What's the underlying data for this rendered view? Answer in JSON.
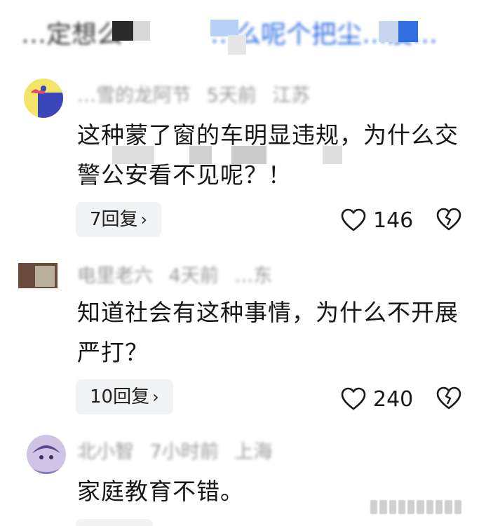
{
  "header": {
    "blurred_left": "…定想么",
    "blurred_right": "…么呢个把尘…没…"
  },
  "comments": [
    {
      "meta_name": "…雪的龙阿节",
      "meta_time": "5天前",
      "meta_location": "江苏",
      "text": "这种蒙了窗的车明显违规，为什么交警公安看不见呢？！",
      "replies_label": "7回复",
      "chevron": "›",
      "likes": "146",
      "avatar_icon": "cartoon-avatar-icon"
    },
    {
      "meta_name": "电里老六",
      "meta_time": "4天前",
      "meta_location": "…东",
      "text": "知道社会有这种事情，为什么不开展严打？",
      "replies_label": "10回复",
      "chevron": "›",
      "likes": "240",
      "avatar_icon": "photo-avatar-icon"
    },
    {
      "meta_name": "北小智",
      "meta_time": "7小时前",
      "meta_location": "上海",
      "text": "家庭教育不错。",
      "avatar_icon": "anime-avatar-icon"
    }
  ],
  "colors": {
    "accent_blue": "#2f6fe0",
    "meta_gray": "#9a9a9a",
    "reply_bg": "#f2f3f5"
  }
}
